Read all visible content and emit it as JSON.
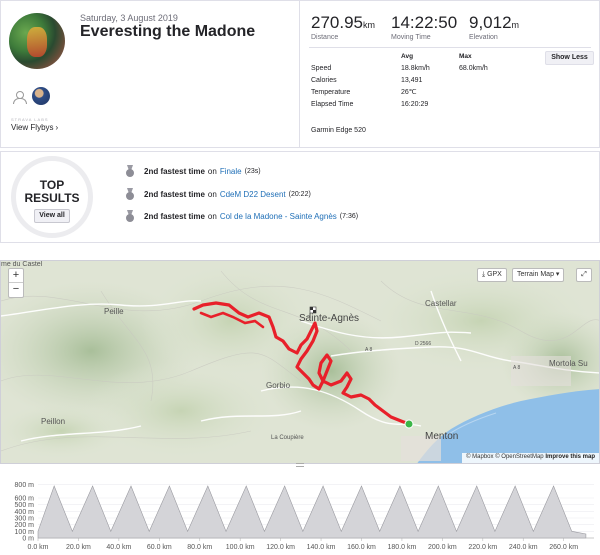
{
  "activity": {
    "date": "Saturday, 3 August 2019",
    "title": "Everesting the Madone",
    "labs_text": "STRAVA LABS",
    "flybys_label": "View Flybys",
    "flybys_chevron": "›"
  },
  "stats": {
    "distance": {
      "value": "270.95",
      "unit": "km",
      "label": "Distance"
    },
    "moving_time": {
      "value": "14:22:50",
      "unit": "",
      "label": "Moving Time"
    },
    "elevation": {
      "value": "9,012",
      "unit": "m",
      "label": "Elevation"
    },
    "table": {
      "headers": [
        "",
        "Avg",
        "Max"
      ],
      "rows": [
        {
          "label": "Speed",
          "avg": "18.8km/h",
          "max": "68.0km/h"
        },
        {
          "label": "Calories",
          "avg": "13,491",
          "max": ""
        },
        {
          "label": "Temperature",
          "avg": "26℃",
          "max": ""
        },
        {
          "label": "Elapsed Time",
          "avg": "16:20:29",
          "max": ""
        }
      ]
    },
    "show_less": "Show Less",
    "device": "Garmin Edge 520"
  },
  "top_results": {
    "title_line1": "TOP",
    "title_line2": "RESULTS",
    "view_all": "View all",
    "items": [
      {
        "rank": "2nd fastest time",
        "on": "on",
        "segment": "Finale",
        "time": "(23s)"
      },
      {
        "rank": "2nd fastest time",
        "on": "on",
        "segment": "CdeM D22 Desent",
        "time": "(20:22)"
      },
      {
        "rank": "2nd fastest time",
        "on": "on",
        "segment": "Col de la Madone - Sainte Agnès",
        "time": "(7:36)"
      }
    ]
  },
  "map": {
    "zoom_in": "+",
    "zoom_out": "−",
    "gpx_label": "GPX",
    "terrain_label": "Terrain Map",
    "expand_icon": "expand-icon",
    "places": {
      "peille": "Peille",
      "sainte_agnes": "Sainte-Agnès",
      "castellar": "Castellar",
      "mortola": "Mortola Su",
      "gorbio": "Gorbio",
      "la_coupiere": "La Coupière",
      "peillon": "Peillon",
      "menton": "Menton",
      "top_left": "me du Castel",
      "road_a8": "A 8",
      "road_d2566": "D 2566",
      "road_a8b": "A 8"
    },
    "attribution": {
      "mapbox": "© Mapbox",
      "osm": "© OpenStreetMap",
      "improve": "Improve this map"
    },
    "route_color": "#e8202a",
    "end_marker_color": "#3cb648",
    "sea_color": "#8fbfe8"
  },
  "chart_data": {
    "type": "area",
    "title": "",
    "xlabel": "",
    "ylabel": "",
    "x_ticks": [
      "0.0 km",
      "20.0 km",
      "40.0 km",
      "60.0 km",
      "80.0 km",
      "100.0 km",
      "120.0 km",
      "140.0 km",
      "160.0 km",
      "180.0 km",
      "200.0 km",
      "220.0 km",
      "240.0 km",
      "260.0 km"
    ],
    "y_ticks": [
      "0 m",
      "100 m",
      "200 m",
      "300 m",
      "400 m",
      "500 m",
      "600 m",
      "800 m"
    ],
    "xlim": [
      0,
      275
    ],
    "ylim": [
      0,
      900
    ],
    "series": [
      {
        "x": [
          0,
          8,
          17,
          27,
          36,
          46,
          55,
          65,
          74,
          84,
          93,
          103,
          112,
          122,
          131,
          141,
          150,
          160,
          169,
          179,
          188,
          198,
          207,
          217,
          226,
          236,
          245,
          255,
          264,
          271
        ],
        "values": [
          100,
          780,
          100,
          780,
          100,
          780,
          100,
          780,
          100,
          780,
          100,
          780,
          100,
          780,
          100,
          780,
          100,
          780,
          100,
          780,
          100,
          780,
          100,
          780,
          100,
          780,
          100,
          780,
          100,
          60
        ]
      }
    ],
    "grid": true,
    "fill_color": "#d4d4d8",
    "line_color": "#9a9aa0"
  }
}
